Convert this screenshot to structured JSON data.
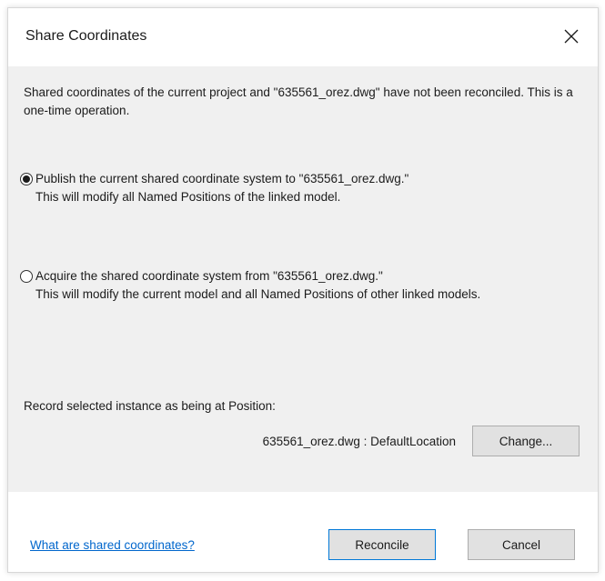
{
  "dialog": {
    "title": "Share Coordinates",
    "message": "Shared coordinates of the current project and \"635561_orez.dwg\" have not been reconciled. This is a one-time operation.",
    "options": [
      {
        "label": "Publish the current shared coordinate system to \"635561_orez.dwg.\"",
        "description": "This will modify all Named Positions of the linked model.",
        "selected": true
      },
      {
        "label": "Acquire the shared coordinate system from \"635561_orez.dwg.\"",
        "description": "This will modify the current model and all Named Positions of other linked models.",
        "selected": false
      }
    ],
    "record_label": "Record selected instance as being at Position:",
    "position_value": "635561_orez.dwg : DefaultLocation",
    "change_label": "Change...",
    "help_link": "What are shared coordinates?",
    "reconcile_label": "Reconcile",
    "cancel_label": "Cancel"
  },
  "icons": {
    "close": "close-icon"
  },
  "colors": {
    "link": "#0066cc",
    "default_button_border": "#0078d7",
    "content_background": "#f0f0f0"
  }
}
